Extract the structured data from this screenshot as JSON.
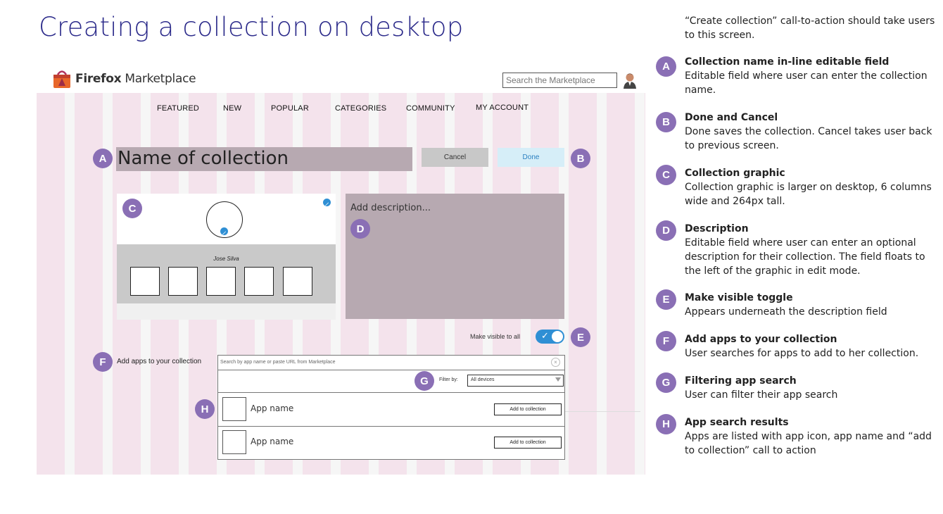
{
  "page_title": "Creating a collection on desktop",
  "header": {
    "logo_brand": "Firefox",
    "logo_product": "Marketplace",
    "search_placeholder": "Search the Marketplace"
  },
  "nav": [
    "FEATURED",
    "NEW",
    "POPULAR",
    "CATEGORIES",
    "COMMUNITY",
    "MY ACCOUNT"
  ],
  "editor": {
    "name_field": "Name of collection",
    "cancel_label": "Cancel",
    "done_label": "Done",
    "graphic_author": "Jose Silva",
    "description_placeholder": "Add description...",
    "visible_label": "Make visible to all",
    "visible_on": true,
    "add_apps_label": "Add apps to your collection",
    "app_search_placeholder": "Search by app name or paste URL from Marketplace",
    "filter_label": "Filter by:",
    "filter_value": "All devices",
    "results": [
      {
        "name": "App name",
        "button": "Add to collection"
      },
      {
        "name": "App name",
        "button": "Add to collection"
      }
    ]
  },
  "badges": [
    "A",
    "B",
    "C",
    "D",
    "E",
    "F",
    "G",
    "H"
  ],
  "notes": {
    "intro": "“Create collection” call-to-action should take users to this screen.",
    "items": [
      {
        "badge": "A",
        "title": "Collection name in-line editable field",
        "body": "Editable field where user can enter the collection name."
      },
      {
        "badge": "B",
        "title": "Done and Cancel",
        "body": "Done saves the collection. Cancel takes user back to previous screen."
      },
      {
        "badge": "C",
        "title": "Collection graphic",
        "body": "Collection graphic is larger on desktop, 6 columns wide and 264px tall."
      },
      {
        "badge": "D",
        "title": "Description",
        "body": "Editable field where user can enter an optional description for their collection. The field floats to the left of the graphic in edit mode."
      },
      {
        "badge": "E",
        "title": "Make visible toggle",
        "body": "Appears underneath the description field"
      },
      {
        "badge": "F",
        "title": "Add apps to your collection",
        "body": "User searches for apps to add to her collection."
      },
      {
        "badge": "G",
        "title": "Filtering app search",
        "body": "User can filter their app search"
      },
      {
        "badge": "H",
        "title": "App search results",
        "body": "Apps are listed with app icon, app name and “add to collection” call to action"
      }
    ]
  },
  "colors": {
    "title": "#2b2a8a",
    "badge": "#8a6fb5",
    "accent": "#2f8fd4",
    "field": "#b7a9b1"
  }
}
